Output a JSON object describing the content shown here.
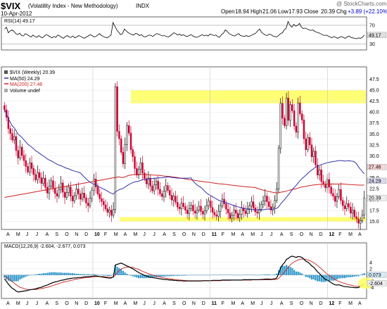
{
  "header": {
    "symbol": "$VIX",
    "name": "(Volatility Index - New Methodology)",
    "exchange": "INDX",
    "date": "10-Apr-2012",
    "watermark": "@ StockCharts.com",
    "ohlc": {
      "open_label": "Open",
      "open": "18.94",
      "high_label": "High",
      "high": "21.06",
      "low_label": "Low",
      "low": "17.93",
      "close_label": "Close",
      "close": "20.39",
      "chg_label": "Chg",
      "chg": "+3.89 (+22.10%)",
      "chg_color": "#0000cc"
    }
  },
  "colors": {
    "up": "#ffffff",
    "down": "#cc0033",
    "ma50": "#3333aa",
    "ma200": "#cc2222",
    "highlight": "#ffff66",
    "macd_line": "#000000",
    "signal_line": "#cc2222",
    "histogram": "#3399cc",
    "rsi_line": "#000000"
  },
  "chart_data": [
    {
      "type": "line",
      "title": "RSI(14) 49.17",
      "indicator": "RSI",
      "period": 14,
      "last_value": 49.17,
      "ylim": [
        20,
        85
      ],
      "y_ticks": [
        70,
        50,
        30
      ],
      "reference_lines": [
        70,
        30
      ],
      "value_label": "49.17",
      "grid": true,
      "values": [
        62,
        66,
        54,
        58,
        60,
        57,
        52,
        50,
        53,
        48,
        47,
        52,
        50,
        47,
        45,
        49,
        46,
        44,
        48,
        45,
        43,
        47,
        50,
        48,
        45,
        43,
        46,
        44,
        49,
        47,
        44,
        42,
        46,
        48,
        45,
        44,
        47,
        43,
        45,
        48,
        46,
        44,
        42,
        45,
        47,
        50,
        48,
        45,
        46,
        49,
        52,
        48,
        46,
        44,
        43,
        46,
        49,
        76,
        68,
        60,
        55,
        50,
        52,
        62,
        58,
        54,
        52,
        50,
        49,
        53,
        51,
        48,
        50,
        46,
        45,
        47,
        49,
        48,
        46,
        50,
        52,
        51,
        49,
        47,
        48,
        46,
        45,
        47,
        50,
        54,
        52,
        49,
        51,
        48,
        50,
        47,
        46,
        48,
        50,
        47,
        45,
        44,
        46,
        48,
        50,
        47,
        49,
        47,
        51,
        50,
        48,
        49,
        46,
        44,
        50,
        53,
        60,
        57,
        52,
        50,
        48,
        47,
        50,
        52,
        48,
        47,
        46,
        48,
        46,
        47,
        49,
        51,
        53,
        58,
        62,
        55,
        52,
        49,
        48,
        51,
        50,
        47,
        46,
        45,
        48,
        52,
        54,
        60,
        64,
        78,
        70,
        66,
        72,
        68,
        70,
        74,
        66,
        63,
        64,
        62,
        60,
        59,
        60,
        57,
        55,
        54,
        52,
        50,
        48,
        49,
        47,
        45,
        43,
        46,
        44,
        42,
        44,
        46,
        44,
        42,
        45,
        47,
        44,
        43,
        42,
        41,
        43,
        42,
        44,
        49
      ]
    },
    {
      "type": "candlestick",
      "title": "$VIX (Weekly) 20.39",
      "ylim": [
        13.5,
        50
      ],
      "y_ticks": [
        15.0,
        17.5,
        20.0,
        22.5,
        25.0,
        27.5,
        30.0,
        32.5,
        35.0,
        37.5,
        40.0,
        42.5,
        45.0,
        47.5
      ],
      "x_tick_labels": [
        "A",
        "M",
        "J",
        "J",
        "A",
        "S",
        "O",
        "N",
        "D",
        "10",
        "F",
        "M",
        "A",
        "M",
        "J",
        "J",
        "A",
        "S",
        "O",
        "N",
        "D",
        "11",
        "F",
        "M",
        "A",
        "M",
        "J",
        "J",
        "A",
        "S",
        "O",
        "N",
        "D",
        "12",
        "F",
        "M",
        "A"
      ],
      "legend": [
        {
          "label": "$VIX (Weekly) 20.39",
          "marker": "square"
        },
        {
          "label": "MA(50) 24.29",
          "color": "#3333aa"
        },
        {
          "label": "MA(200) 27.46",
          "color": "#cc2222"
        },
        {
          "label": "Volume undef",
          "marker": "square-gray"
        }
      ],
      "ma_labels": {
        "ma200": "27.46",
        "ma50": "24.29",
        "close": "20.39"
      },
      "highlight_zones": [
        [
          42.0,
          45.0
        ],
        [
          15.0,
          16.0
        ]
      ],
      "close": [
        40.5,
        38.8,
        36.2,
        35.1,
        33.6,
        34.4,
        31.2,
        29.5,
        32.0,
        30.1,
        28.9,
        27.6,
        26.3,
        28.4,
        27.1,
        25.7,
        24.5,
        26.2,
        25.0,
        23.7,
        24.9,
        22.8,
        21.5,
        23.1,
        24.3,
        22.6,
        21.4,
        20.8,
        22.3,
        23.8,
        21.7,
        20.5,
        21.6,
        22.9,
        20.8,
        19.7,
        20.9,
        22.4,
        21.3,
        20.1,
        21.5,
        20.4,
        19.2,
        18.6,
        20.3,
        22.1,
        24.7,
        22.9,
        21.3,
        20.2,
        19.6,
        18.8,
        17.9,
        17.1,
        17.6,
        16.4,
        17.8,
        45.8,
        35.6,
        33.9,
        30.8,
        28.2,
        32.6,
        36.9,
        35.2,
        31.4,
        29.8,
        27.1,
        25.6,
        26.9,
        28.4,
        26.1,
        24.8,
        23.6,
        24.9,
        23.1,
        22.0,
        23.4,
        24.2,
        22.4,
        21.3,
        20.7,
        21.9,
        23.2,
        22.1,
        21.0,
        19.9,
        20.8,
        19.4,
        18.3,
        17.9,
        19.2,
        18.4,
        17.6,
        16.8,
        17.9,
        18.7,
        17.4,
        16.9,
        17.6,
        18.5,
        17.3,
        16.7,
        17.4,
        18.6,
        19.7,
        18.2,
        17.1,
        16.5,
        16.2,
        17.3,
        18.6,
        20.1,
        19.0,
        17.8,
        16.9,
        15.7,
        16.4,
        17.6,
        16.9,
        15.8,
        16.6,
        18.1,
        17.4,
        16.8,
        17.9,
        18.6,
        19.5,
        18.1,
        17.2,
        16.9,
        17.8,
        18.9,
        19.7,
        20.8,
        19.5,
        18.4,
        17.6,
        18.3,
        19.8,
        22.4,
        31.7,
        42.0,
        38.6,
        36.9,
        43.2,
        38.1,
        41.7,
        40.3,
        36.8,
        35.4,
        42.1,
        39.6,
        38.2,
        33.9,
        31.4,
        34.2,
        32.5,
        29.8,
        31.1,
        27.9,
        25.6,
        26.8,
        24.1,
        23.5,
        22.7,
        24.6,
        22.9,
        21.4,
        20.8,
        19.6,
        20.7,
        22.3,
        19.8,
        18.6,
        17.9,
        19.1,
        18.3,
        16.9,
        17.6,
        16.1,
        15.6,
        14.6,
        15.2,
        16.5,
        20.4
      ]
    },
    {
      "type": "line",
      "title": "MACD(12,26,9) -2.604, -2.677, 0.073",
      "indicator": "MACD",
      "params": [
        12,
        26,
        9
      ],
      "legend_values": {
        "macd": "-2.604",
        "signal": "-2.677",
        "histogram": "0.073"
      },
      "value_labels": [
        "0.073",
        "-2.604"
      ],
      "ylim": [
        -7,
        8
      ],
      "y_ticks": [
        4,
        2,
        0,
        -2,
        -4
      ],
      "grid": true,
      "macd": [
        -1.2,
        -2.0,
        -2.9,
        -3.6,
        -4.2,
        -4.6,
        -5.1,
        -5.4,
        -5.3,
        -5.2,
        -5.1,
        -5.0,
        -4.9,
        -4.7,
        -4.6,
        -4.5,
        -4.4,
        -4.2,
        -4.0,
        -3.9,
        -3.6,
        -3.4,
        -3.2,
        -2.9,
        -2.6,
        -2.4,
        -2.2,
        -2.1,
        -1.9,
        -1.7,
        -1.6,
        -1.5,
        -1.3,
        -1.2,
        -1.1,
        -1.0,
        -0.9,
        -0.9,
        -0.8,
        -0.8,
        -0.7,
        -0.6,
        -0.6,
        -0.5,
        -0.5,
        -0.4,
        -0.3,
        -0.3,
        -0.4,
        -0.5,
        -0.6,
        -0.7,
        -0.8,
        -0.9,
        -1.0,
        -0.9,
        -0.6,
        3.2,
        3.4,
        3.6,
        3.8,
        3.5,
        3.2,
        2.9,
        2.6,
        2.3,
        2.0,
        1.6,
        1.2,
        0.8,
        0.5,
        0.2,
        -0.1,
        -0.3,
        -0.5,
        -0.7,
        -0.8,
        -0.9,
        -1.0,
        -1.1,
        -1.2,
        -1.3,
        -1.4,
        -1.4,
        -1.5,
        -1.6,
        -1.6,
        -1.7,
        -1.7,
        -1.8,
        -1.8,
        -1.8,
        -1.9,
        -1.9,
        -1.9,
        -1.9,
        -1.9,
        -1.9,
        -1.9,
        -1.9,
        -1.9,
        -1.9,
        -1.8,
        -1.8,
        -1.8,
        -1.8,
        -1.8,
        -1.7,
        -1.7,
        -1.7,
        -1.7,
        -1.7,
        -1.6,
        -1.6,
        -1.6,
        -1.6,
        -1.6,
        -1.6,
        -1.6,
        -1.6,
        -1.6,
        -1.6,
        -1.6,
        -1.5,
        -1.5,
        -1.5,
        -1.5,
        -1.5,
        -1.5,
        -1.5,
        -1.5,
        -1.5,
        -1.4,
        -1.4,
        -1.3,
        -1.3,
        -1.3,
        -1.4,
        -1.3,
        -1.2,
        -0.9,
        0.4,
        2.3,
        3.3,
        3.9,
        5.0,
        5.3,
        5.8,
        6.0,
        5.8,
        5.6,
        5.9,
        5.8,
        5.6,
        5.0,
        4.4,
        4.1,
        3.6,
        2.9,
        2.5,
        1.8,
        1.0,
        0.5,
        -0.2,
        -0.8,
        -1.4,
        -1.6,
        -2.0,
        -2.4,
        -2.8,
        -3.1,
        -3.2,
        -3.1,
        -3.3,
        -3.5,
        -3.7,
        -3.7,
        -3.8,
        -3.9,
        -3.9,
        -4.0,
        -4.0,
        -4.0,
        -3.6,
        -3.2,
        -2.6
      ],
      "signal": [
        -0.3,
        -0.6,
        -1.1,
        -1.6,
        -2.1,
        -2.6,
        -3.1,
        -3.5,
        -3.9,
        -4.1,
        -4.3,
        -4.5,
        -4.6,
        -4.6,
        -4.6,
        -4.6,
        -4.6,
        -4.5,
        -4.4,
        -4.3,
        -4.2,
        -4.0,
        -3.9,
        -3.7,
        -3.5,
        -3.3,
        -3.1,
        -2.9,
        -2.7,
        -2.5,
        -2.3,
        -2.2,
        -2.0,
        -1.9,
        -1.7,
        -1.6,
        -1.4,
        -1.3,
        -1.2,
        -1.1,
        -1.0,
        -0.9,
        -0.8,
        -0.8,
        -0.7,
        -0.6,
        -0.6,
        -0.5,
        -0.5,
        -0.5,
        -0.5,
        -0.5,
        -0.6,
        -0.6,
        -0.7,
        -0.7,
        -0.7,
        0.1,
        0.8,
        1.4,
        1.9,
        2.2,
        2.4,
        2.5,
        2.5,
        2.5,
        2.4,
        2.2,
        2.0,
        1.8,
        1.5,
        1.2,
        0.9,
        0.7,
        0.4,
        0.2,
        0.0,
        -0.2,
        -0.3,
        -0.5,
        -0.6,
        -0.8,
        -0.9,
        -1.0,
        -1.1,
        -1.2,
        -1.3,
        -1.4,
        -1.5,
        -1.5,
        -1.6,
        -1.6,
        -1.7,
        -1.7,
        -1.8,
        -1.8,
        -1.8,
        -1.8,
        -1.8,
        -1.8,
        -1.8,
        -1.8,
        -1.8,
        -1.8,
        -1.8,
        -1.8,
        -1.8,
        -1.8,
        -1.8,
        -1.8,
        -1.8,
        -1.8,
        -1.7,
        -1.7,
        -1.7,
        -1.7,
        -1.7,
        -1.6,
        -1.6,
        -1.6,
        -1.6,
        -1.6,
        -1.6,
        -1.6,
        -1.6,
        -1.6,
        -1.6,
        -1.6,
        -1.5,
        -1.5,
        -1.5,
        -1.5,
        -1.5,
        -1.5,
        -1.5,
        -1.5,
        -1.5,
        -1.5,
        -1.4,
        -1.4,
        -1.4,
        -1.1,
        -0.4,
        0.3,
        1.0,
        1.8,
        2.5,
        3.2,
        3.8,
        4.2,
        4.5,
        4.8,
        5.0,
        5.1,
        5.1,
        5.0,
        4.8,
        4.6,
        4.3,
        3.9,
        3.5,
        3.0,
        2.5,
        2.0,
        1.4,
        0.8,
        0.3,
        -0.1,
        -0.6,
        -1.0,
        -1.4,
        -1.8,
        -2.0,
        -2.3,
        -2.5,
        -2.7,
        -2.9,
        -3.1,
        -3.2,
        -3.3,
        -3.5,
        -3.6,
        -3.6,
        -3.6,
        -3.5,
        -3.2
      ]
    }
  ]
}
